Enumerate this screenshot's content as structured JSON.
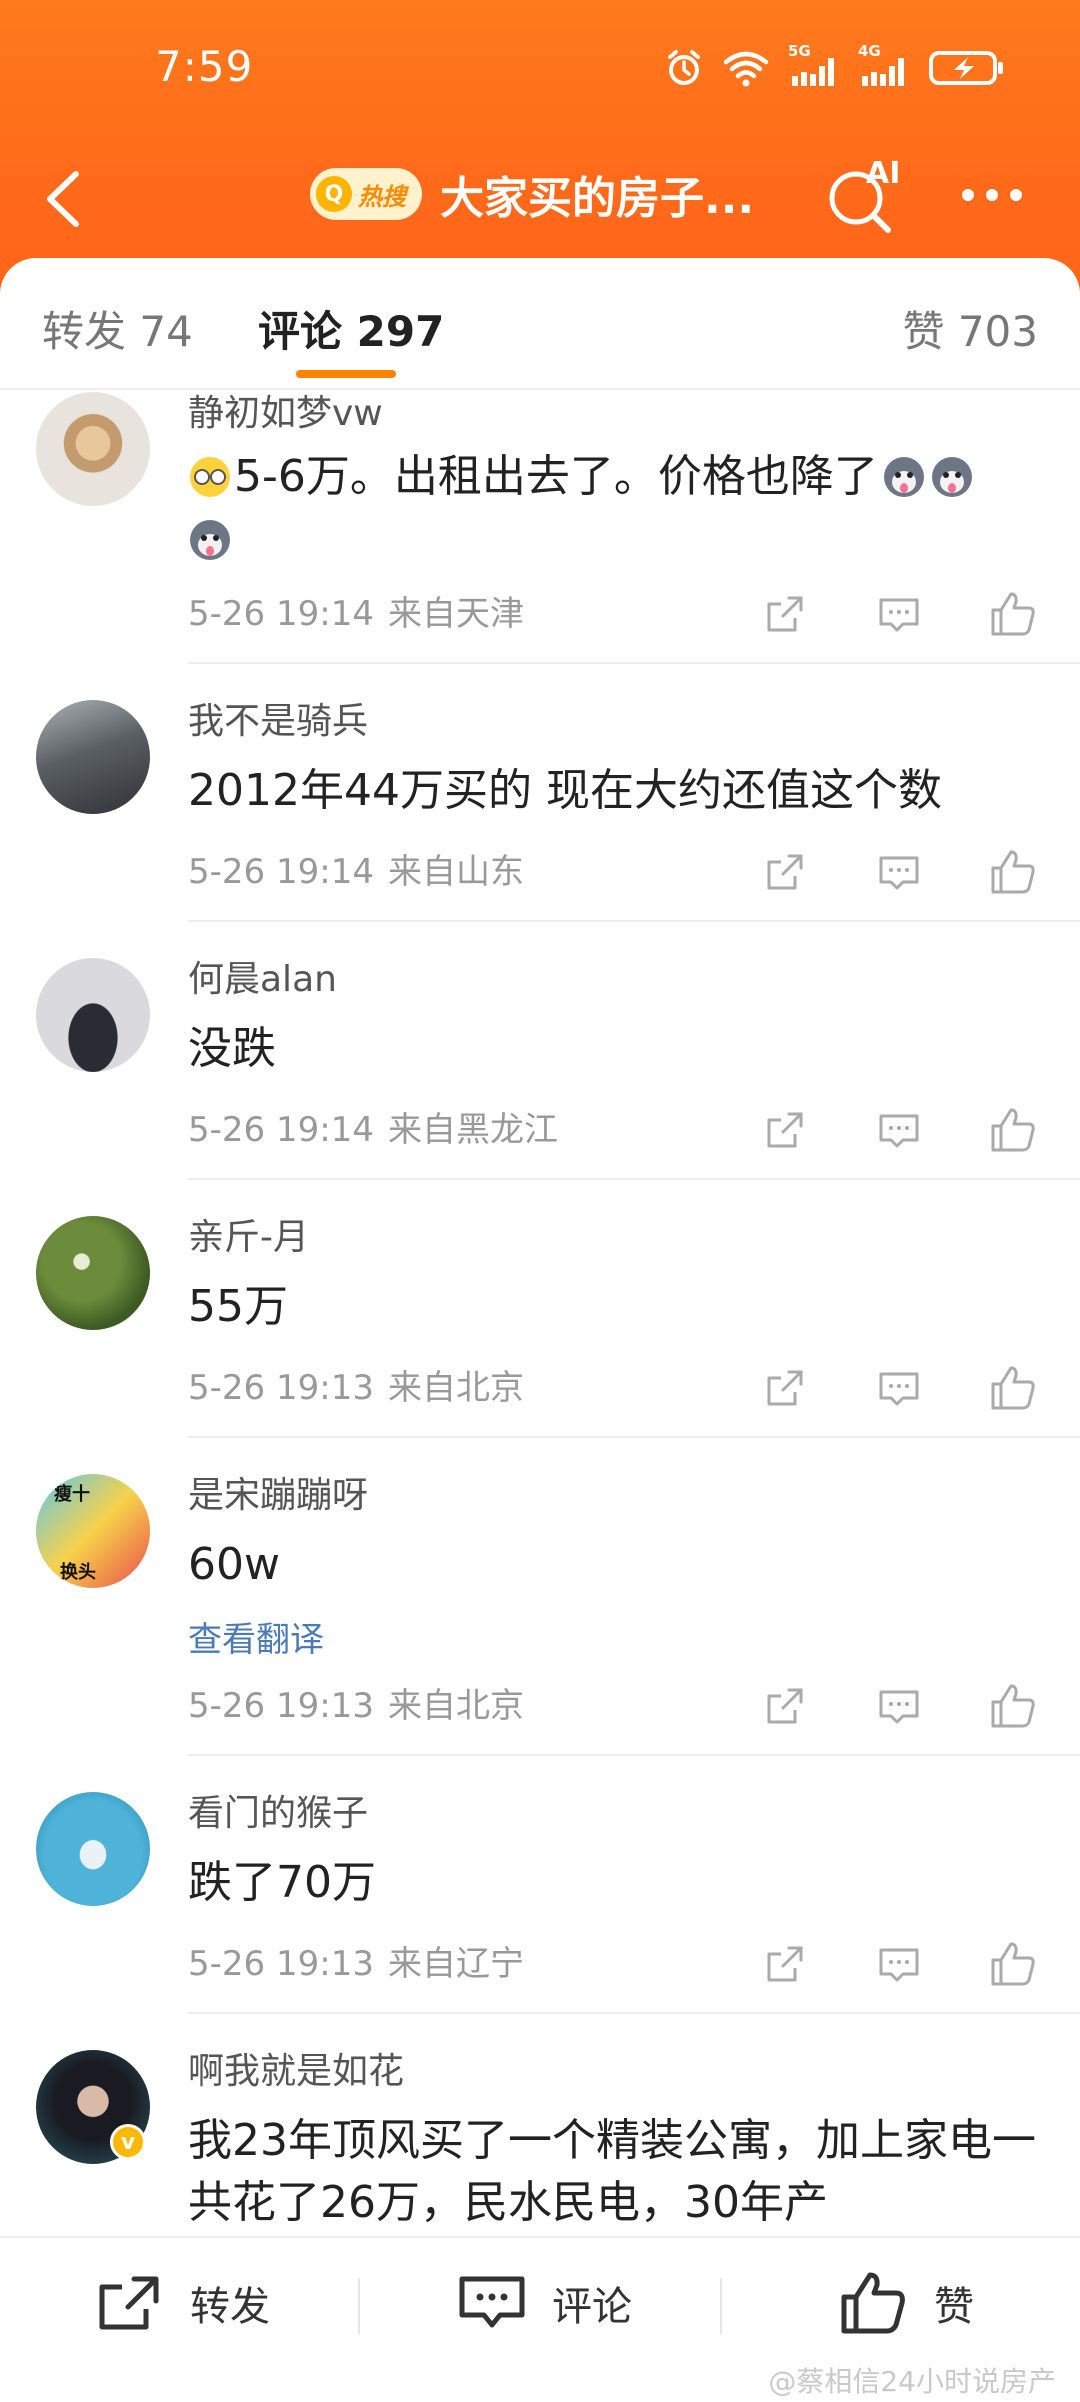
{
  "status_bar": {
    "time": "7:59",
    "net1": "5G",
    "net2": "4G"
  },
  "nav": {
    "badge_text": "热搜",
    "title": "大家买的房子...",
    "ai_label": "AI"
  },
  "tabs": {
    "repost": "转发 74",
    "comment": "评论 297",
    "like": "赞 703"
  },
  "comments": [
    {
      "name": "静初如梦vw",
      "text": "5-6万。出租出去了。价格也降了",
      "time": "5-26 19:14",
      "from": "来自天津"
    },
    {
      "name": "我不是骑兵",
      "text": "2012年44万买的 现在大约还值这个数",
      "time": "5-26 19:14",
      "from": "来自山东"
    },
    {
      "name": "何晨alan",
      "text": "没跌",
      "time": "5-26 19:14",
      "from": "来自黑龙江"
    },
    {
      "name": "亲斤-月",
      "text": "55万",
      "time": "5-26 19:13",
      "from": "来自北京"
    },
    {
      "name": "是宋蹦蹦呀",
      "text": "60w",
      "translate": "查看翻译",
      "time": "5-26 19:13",
      "from": "来自北京"
    },
    {
      "name": "看门的猴子",
      "text": "跌了70万",
      "time": "5-26 19:13",
      "from": "来自辽宁"
    },
    {
      "name": "啊我就是如花",
      "text": "我23年顶风买了一个精装公寓，加上家电一共花了26万，民水民电，30年产"
    }
  ],
  "avatar_texts": {
    "c4_top": "瘦十",
    "c4_bottom": "换头"
  },
  "bottom_bar": {
    "repost": "转发",
    "comment": "评论",
    "like": "赞"
  },
  "watermark": "@蔡相信24小时说房产",
  "colors": {
    "header": "#ff6a1a",
    "accent": "#ff8200",
    "link": "#4a7bb7"
  }
}
